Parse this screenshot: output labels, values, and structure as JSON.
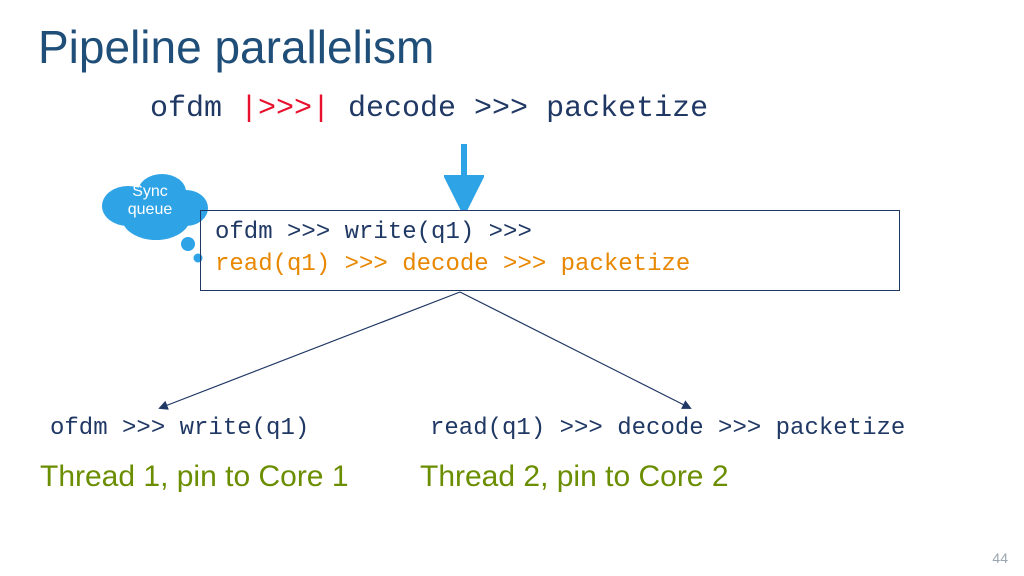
{
  "title": "Pipeline parallelism",
  "topcode": {
    "seg1": "ofdm ",
    "seg2": "|>>>|",
    "seg3": " decode >>> packetize"
  },
  "cloud": "Sync\nqueue",
  "codebox": {
    "line1": "ofdm >>> write(q1) >>>",
    "line2": "read(q1) >>> decode >>> packetize"
  },
  "leaves": {
    "left": "ofdm >>> write(q1)",
    "right": "read(q1) >>> decode >>> packetize"
  },
  "threads": {
    "t1": "Thread 1, pin to Core 1",
    "t2": "Thread 2, pin to Core 2"
  },
  "pagenum": "44",
  "colors": {
    "navy": "#203864",
    "red": "#e8112d",
    "orange": "#e88700",
    "olive": "#6b8e00",
    "cloud": "#2ea3e6",
    "arrow": "#2ea3e6"
  }
}
